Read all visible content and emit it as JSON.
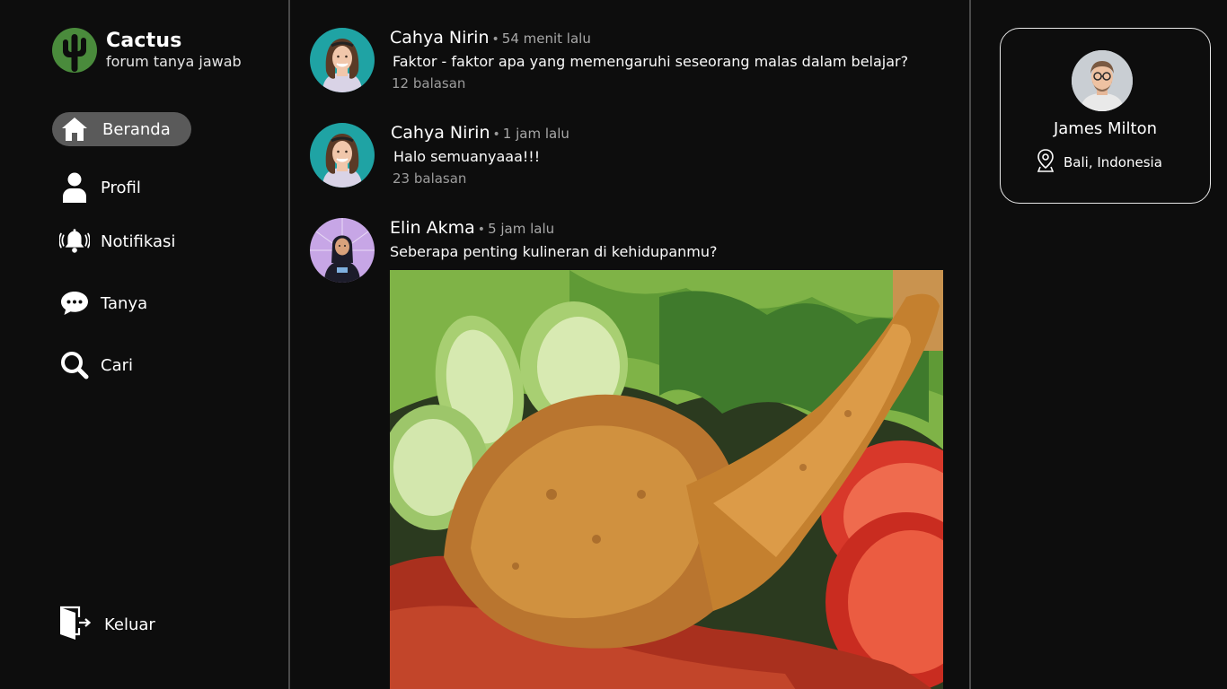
{
  "brand": {
    "name": "Cactus",
    "tagline": "forum tanya jawab",
    "logo_icon": "cactus-icon",
    "logo_color": "#4a8b3c"
  },
  "nav": {
    "items": [
      {
        "label": "Beranda",
        "icon": "home-icon",
        "active": true
      },
      {
        "label": "Profil",
        "icon": "user-icon"
      },
      {
        "label": "Notifikasi",
        "icon": "bell-icon"
      },
      {
        "label": "Tanya",
        "icon": "chat-bubble-icon"
      },
      {
        "label": "Cari",
        "icon": "search-icon"
      }
    ],
    "logout": {
      "label": "Keluar",
      "icon": "logout-door-icon"
    }
  },
  "feed": {
    "posts": [
      {
        "author": "Cahya Nirin",
        "time": "54 menit lalu",
        "text": "Faktor - faktor apa yang memengaruhi seseorang malas dalam belajar?",
        "replies": "12 balasan"
      },
      {
        "author": "Cahya Nirin",
        "time": "1 jam lalu",
        "text": "Halo semuanyaaa!!!",
        "replies": "23 balasan"
      },
      {
        "author": "Elin Akma",
        "time": "5 jam lalu",
        "text": "Seberapa penting kulineran di kehidupanmu?",
        "image": "fried-chicken-photo"
      }
    ]
  },
  "profile": {
    "name": "James Milton",
    "location": "Bali, Indonesia",
    "location_icon": "location-pin-icon"
  },
  "colors": {
    "background": "#0d0d0d",
    "active_nav": "#5a5a5a",
    "divider": "#4a4a4a",
    "avatar_teal": "#1fa3a4",
    "avatar_purple": "#c7a6e6"
  }
}
